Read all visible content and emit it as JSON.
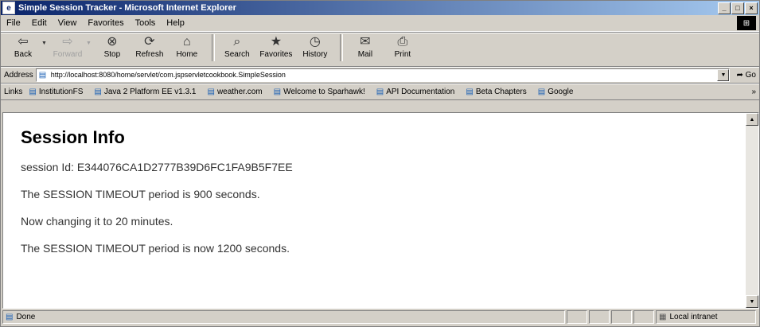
{
  "window": {
    "title": "Simple Session Tracker - Microsoft Internet Explorer"
  },
  "menu": {
    "items": [
      "File",
      "Edit",
      "View",
      "Favorites",
      "Tools",
      "Help"
    ]
  },
  "toolbar": {
    "buttons": [
      {
        "label": "Back",
        "icon": "back-arrow-icon"
      },
      {
        "label": "Forward",
        "icon": "forward-arrow-icon"
      },
      {
        "label": "Stop",
        "icon": "stop-icon"
      },
      {
        "label": "Refresh",
        "icon": "refresh-icon"
      },
      {
        "label": "Home",
        "icon": "home-icon"
      },
      {
        "label": "Search",
        "icon": "search-icon"
      },
      {
        "label": "Favorites",
        "icon": "favorites-icon"
      },
      {
        "label": "History",
        "icon": "history-icon"
      },
      {
        "label": "Mail",
        "icon": "mail-icon"
      },
      {
        "label": "Print",
        "icon": "print-icon"
      }
    ]
  },
  "address": {
    "label": "Address",
    "url": "http://localhost:8080/home/servlet/com.jspservletcookbook.SimpleSession",
    "go_label": "Go"
  },
  "links": {
    "label": "Links",
    "items": [
      "InstitutionFS",
      "Java 2 Platform EE v1.3.1",
      "weather.com",
      "Welcome to Sparhawk!",
      "API Documentation",
      "Beta Chapters",
      "Google"
    ],
    "more": "»"
  },
  "page": {
    "heading": "Session Info",
    "lines": [
      "session Id: E344076CA1D2777B39D6FC1FA9B5F7EE",
      "The SESSION TIMEOUT period is 900 seconds.",
      "Now changing it to 20 minutes.",
      "The SESSION TIMEOUT period is now 1200 seconds."
    ]
  },
  "status": {
    "text": "Done",
    "zone": "Local intranet"
  }
}
